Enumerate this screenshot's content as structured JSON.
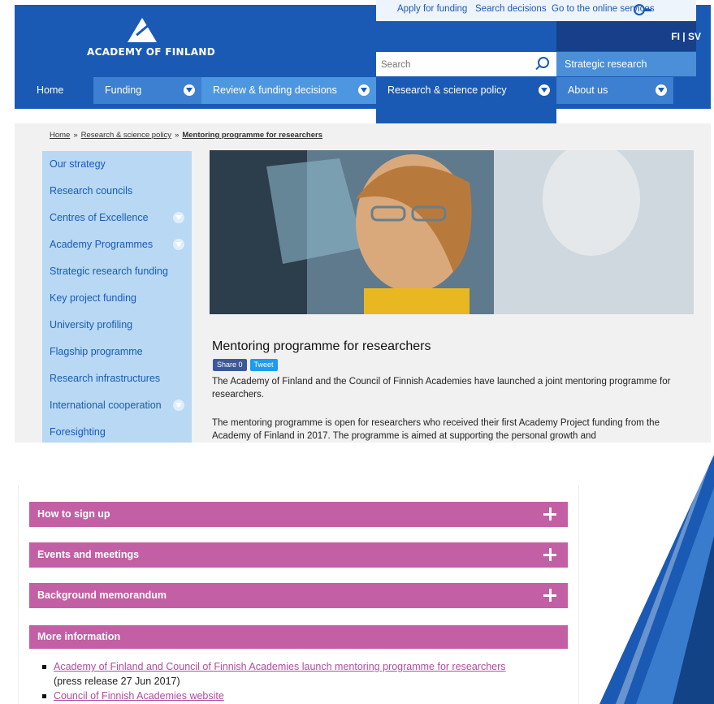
{
  "header": {
    "logo_text": "ACADEMY OF FINLAND",
    "util_links": [
      "Apply for funding",
      "Search decisions",
      "Go to the online services"
    ],
    "lang": "FI | SV",
    "search_placeholder": "Search",
    "strategic": "Strategic research"
  },
  "nav": [
    {
      "label": "Home",
      "arrow": false
    },
    {
      "label": "Funding",
      "arrow": true
    },
    {
      "label": "Review & funding decisions",
      "arrow": true
    },
    {
      "label": "Research & science policy",
      "arrow": true
    },
    {
      "label": "About us",
      "arrow": true
    }
  ],
  "breadcrumb": {
    "home": "Home",
    "sep": "»",
    "level2": "Research & science policy",
    "current": "Mentoring programme for researchers"
  },
  "sidebar": [
    {
      "label": "Our strategy",
      "arrow": false
    },
    {
      "label": "Research councils",
      "arrow": false
    },
    {
      "label": "Centres of Excellence",
      "arrow": true
    },
    {
      "label": "Academy Programmes",
      "arrow": true
    },
    {
      "label": "Strategic research funding",
      "arrow": false
    },
    {
      "label": "Key project funding",
      "arrow": false
    },
    {
      "label": "University profiling",
      "arrow": false
    },
    {
      "label": "Flagship programme",
      "arrow": false
    },
    {
      "label": "Research infrastructures",
      "arrow": false
    },
    {
      "label": "International cooperation",
      "arrow": true
    },
    {
      "label": "Foresighting",
      "arrow": false
    }
  ],
  "article": {
    "title": "Mentoring programme for researchers",
    "share_label": "Share 0",
    "tweet_label": "Tweet",
    "p1": "The Academy of Finland and the Council of Finnish Academies have launched a joint mentoring programme for researchers.",
    "p2": "The mentoring programme is open for researchers who received their first Academy Project funding from the Academy of Finland in 2017. The programme is aimed at supporting the personal growth and"
  },
  "accordions": [
    "How to sign up",
    "Events and meetings",
    "Background memorandum"
  ],
  "more_info": {
    "heading": "More information",
    "links": [
      {
        "text": "Academy of Finland and Council of Finnish Academies launch mentoring programme for researchers",
        "note": "(press release 27 Jun 2017)"
      },
      {
        "text": "Council of Finnish Academies website",
        "note": ""
      }
    ]
  }
}
